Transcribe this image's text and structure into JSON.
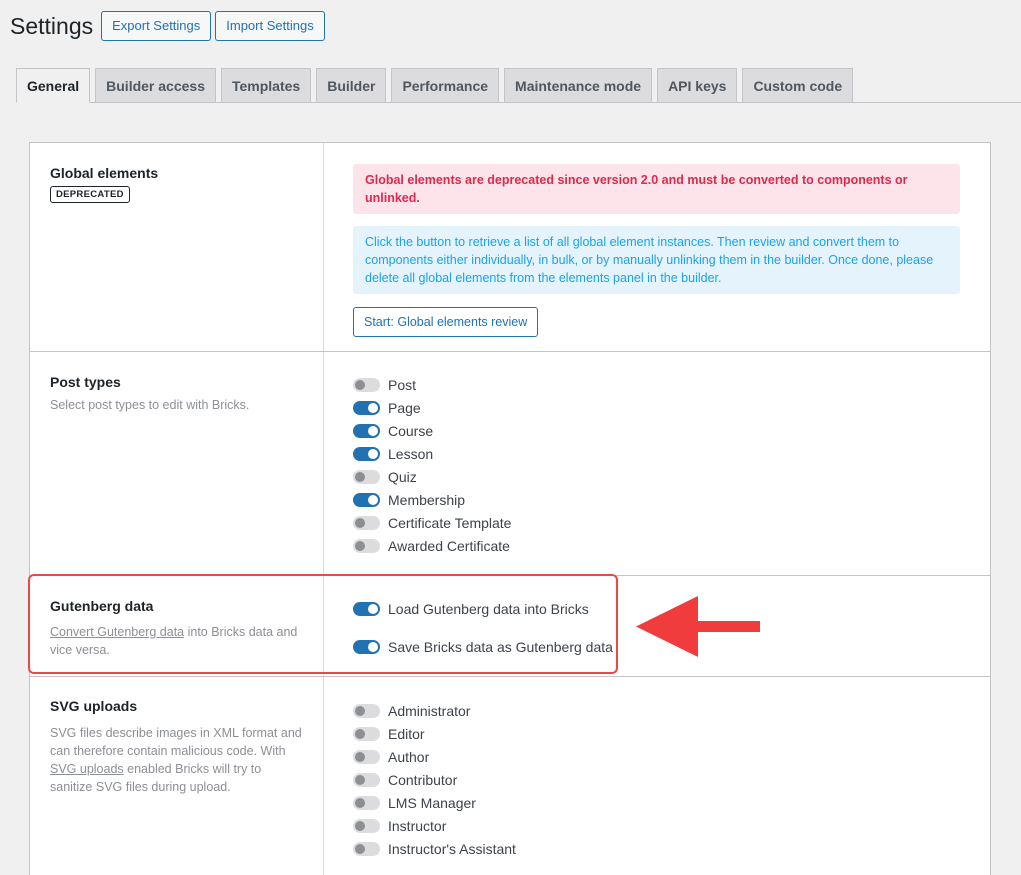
{
  "header": {
    "title": "Settings",
    "export_label": "Export Settings",
    "import_label": "Import Settings"
  },
  "tabs": [
    {
      "label": "General",
      "active": true
    },
    {
      "label": "Builder access"
    },
    {
      "label": "Templates"
    },
    {
      "label": "Builder"
    },
    {
      "label": "Performance"
    },
    {
      "label": "Maintenance mode"
    },
    {
      "label": "API keys"
    },
    {
      "label": "Custom code"
    }
  ],
  "global_elements": {
    "title": "Global elements",
    "badge": "DEPRECATED",
    "error_notice": "Global elements are deprecated since version 2.0 and must be converted to components or unlinked.",
    "info_notice": "Click the button to retrieve a list of all global element instances. Then review and convert them to components either individually, in bulk, or by manually unlinking them in the builder. Once done, please delete all global elements from the elements panel in the builder.",
    "button_label": "Start: Global elements review"
  },
  "post_types": {
    "title": "Post types",
    "desc": "Select post types to edit with Bricks.",
    "items": [
      {
        "label": "Post",
        "on": false
      },
      {
        "label": "Page",
        "on": true
      },
      {
        "label": "Course",
        "on": true
      },
      {
        "label": "Lesson",
        "on": true
      },
      {
        "label": "Quiz",
        "on": false
      },
      {
        "label": "Membership",
        "on": true
      },
      {
        "label": "Certificate Template",
        "on": false
      },
      {
        "label": "Awarded Certificate",
        "on": false
      }
    ]
  },
  "gutenberg": {
    "title": "Gutenberg data",
    "desc_link": "Convert Gutenberg data",
    "desc_rest": " into Bricks data and vice versa.",
    "items": [
      {
        "label": "Load Gutenberg data into Bricks",
        "on": true
      },
      {
        "label": "Save Bricks data as Gutenberg data",
        "on": true
      }
    ]
  },
  "svg": {
    "title": "SVG uploads",
    "desc_before": "SVG files describe images in XML format and can therefore contain malicious code. With ",
    "desc_link": "SVG uploads",
    "desc_after": " enabled Bricks will try to sanitize SVG files during upload.",
    "items": [
      {
        "label": "Administrator",
        "on": false
      },
      {
        "label": "Editor",
        "on": false
      },
      {
        "label": "Author",
        "on": false
      },
      {
        "label": "Contributor",
        "on": false
      },
      {
        "label": "LMS Manager",
        "on": false
      },
      {
        "label": "Instructor",
        "on": false
      },
      {
        "label": "Instructor's Assistant",
        "on": false
      }
    ]
  },
  "colors": {
    "accent": "#2271b1",
    "highlight": "#e84a4a",
    "error_text": "#e0284e",
    "info_text": "#1aa3e8"
  }
}
